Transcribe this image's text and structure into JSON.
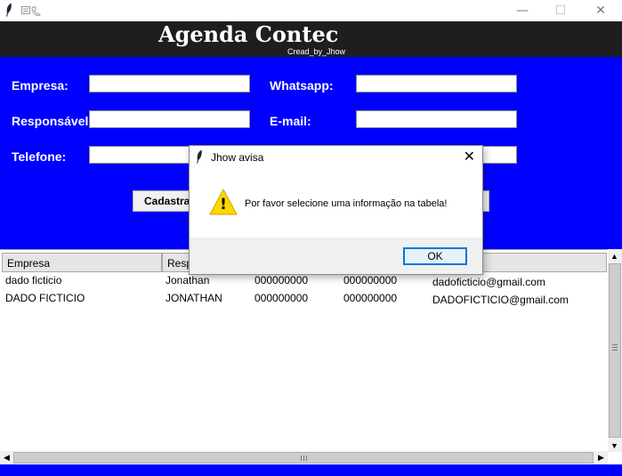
{
  "window": {
    "minimize": "—",
    "maximize": "☐",
    "close": "✕"
  },
  "header": {
    "title": "Agenda Contec",
    "subtitle": "Cread_by_Jhow"
  },
  "form": {
    "empresa_label": "Empresa:",
    "responsavel_label": "Responsável:",
    "telefone_label": "Telefone:",
    "whatsapp_label": "Whatsapp:",
    "email_label": "E-mail:",
    "empresa_value": "",
    "responsavel_value": "",
    "telefone_value": "",
    "whatsapp_value": "",
    "email_value": "",
    "cadastrar_button": "Cadastra"
  },
  "table": {
    "columns": [
      "Empresa",
      "Resp"
    ],
    "rows": [
      [
        "dado ficticio",
        "Jonathan",
        "000000000",
        "000000000",
        "dadoficticio@gmail.com"
      ],
      [
        "DADO FICTICIO",
        "JONATHAN",
        "000000000",
        "000000000",
        "DADOFICTICIO@gmail.com"
      ]
    ]
  },
  "dialog": {
    "title": "Jhow avisa",
    "close": "✕",
    "icon": "warning-icon",
    "warning_glyph": "!",
    "message": "Por favor selecione uma informação na tabela!",
    "ok_button": "OK"
  },
  "colors": {
    "form_bg": "#0000ff",
    "header_bg": "#1e1e1e",
    "warning": "#ffd800",
    "dialog_ok_border": "#0078d7"
  }
}
